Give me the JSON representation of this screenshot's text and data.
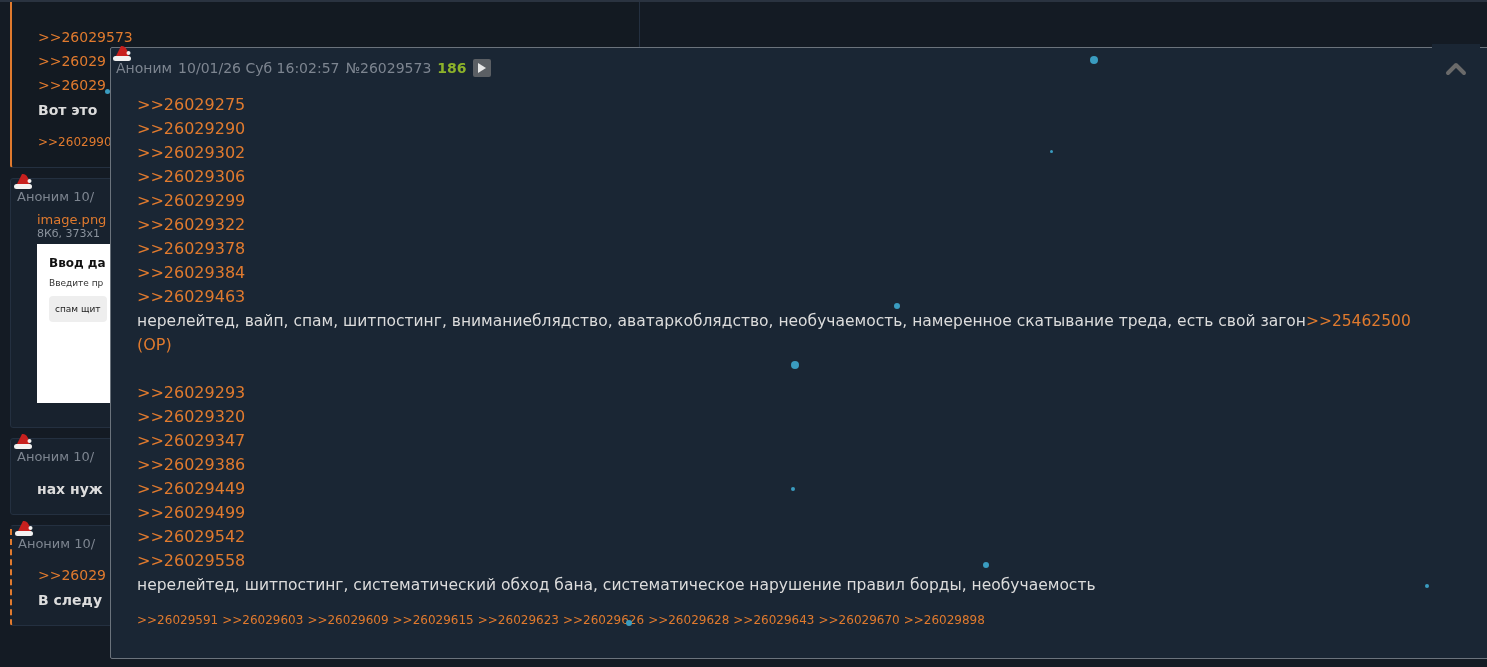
{
  "posts": [
    {
      "kind": "marked",
      "lines": [
        {
          "kind": "link",
          "text": ">>26029573"
        },
        {
          "kind": "link",
          "text": ">>26029"
        },
        {
          "kind": "link",
          "text": ">>26029"
        },
        {
          "kind": "text",
          "text": "Вот это"
        }
      ],
      "replies": [
        ">>2602990"
      ]
    },
    {
      "kind": "plain",
      "header": {
        "author": "Аноним",
        "date": "10/"
      },
      "file": {
        "name": "image.png",
        "info": "8Кб, 373x1",
        "thumb_title": "Ввод да",
        "thumb_hint": "Введите пр",
        "thumb_value": "спам щит"
      }
    },
    {
      "kind": "plain",
      "header": {
        "author": "Аноним",
        "date": "10/"
      },
      "lines": [
        {
          "kind": "text",
          "text": "нах нуж"
        }
      ]
    },
    {
      "kind": "linked",
      "header": {
        "author": "Аноним",
        "date": "10/"
      },
      "lines": [
        {
          "kind": "link",
          "text": ">>26029"
        },
        {
          "kind": "text",
          "text": "В следу"
        }
      ]
    }
  ],
  "popup": {
    "author": "Аноним",
    "date": "10/01/26 Суб 16:02:57",
    "number": "№26029573",
    "count": "186",
    "blocks": [
      {
        "links": [
          ">>26029275",
          ">>26029290",
          ">>26029302",
          ">>26029306",
          ">>26029299",
          ">>26029322",
          ">>26029378",
          ">>26029384",
          ">>26029463"
        ],
        "text": "нерелейтед, вайп, спам, шитпостинг, вниманиеблядство, аватаркоблядство, необучаемость, намеренное скатывание треда, есть свой загон",
        "op_link": ">>25462500",
        "op_mark": "(OP)"
      },
      {
        "links": [
          ">>26029293",
          ">>26029320",
          ">>26029347",
          ">>26029386",
          ">>26029449",
          ">>26029499",
          ">>26029542",
          ">>26029558"
        ],
        "text": "нерелейтед, шитпостинг, систематический обход бана, систематическое нарушение правил борды, необучаемость"
      }
    ],
    "replies": [
      ">>26029591",
      ">>26029603",
      ">>26029609",
      ">>26029615",
      ">>26029623",
      ">>26029626",
      ">>26029628",
      ">>26029643",
      ">>26029670",
      ">>26029898"
    ]
  }
}
